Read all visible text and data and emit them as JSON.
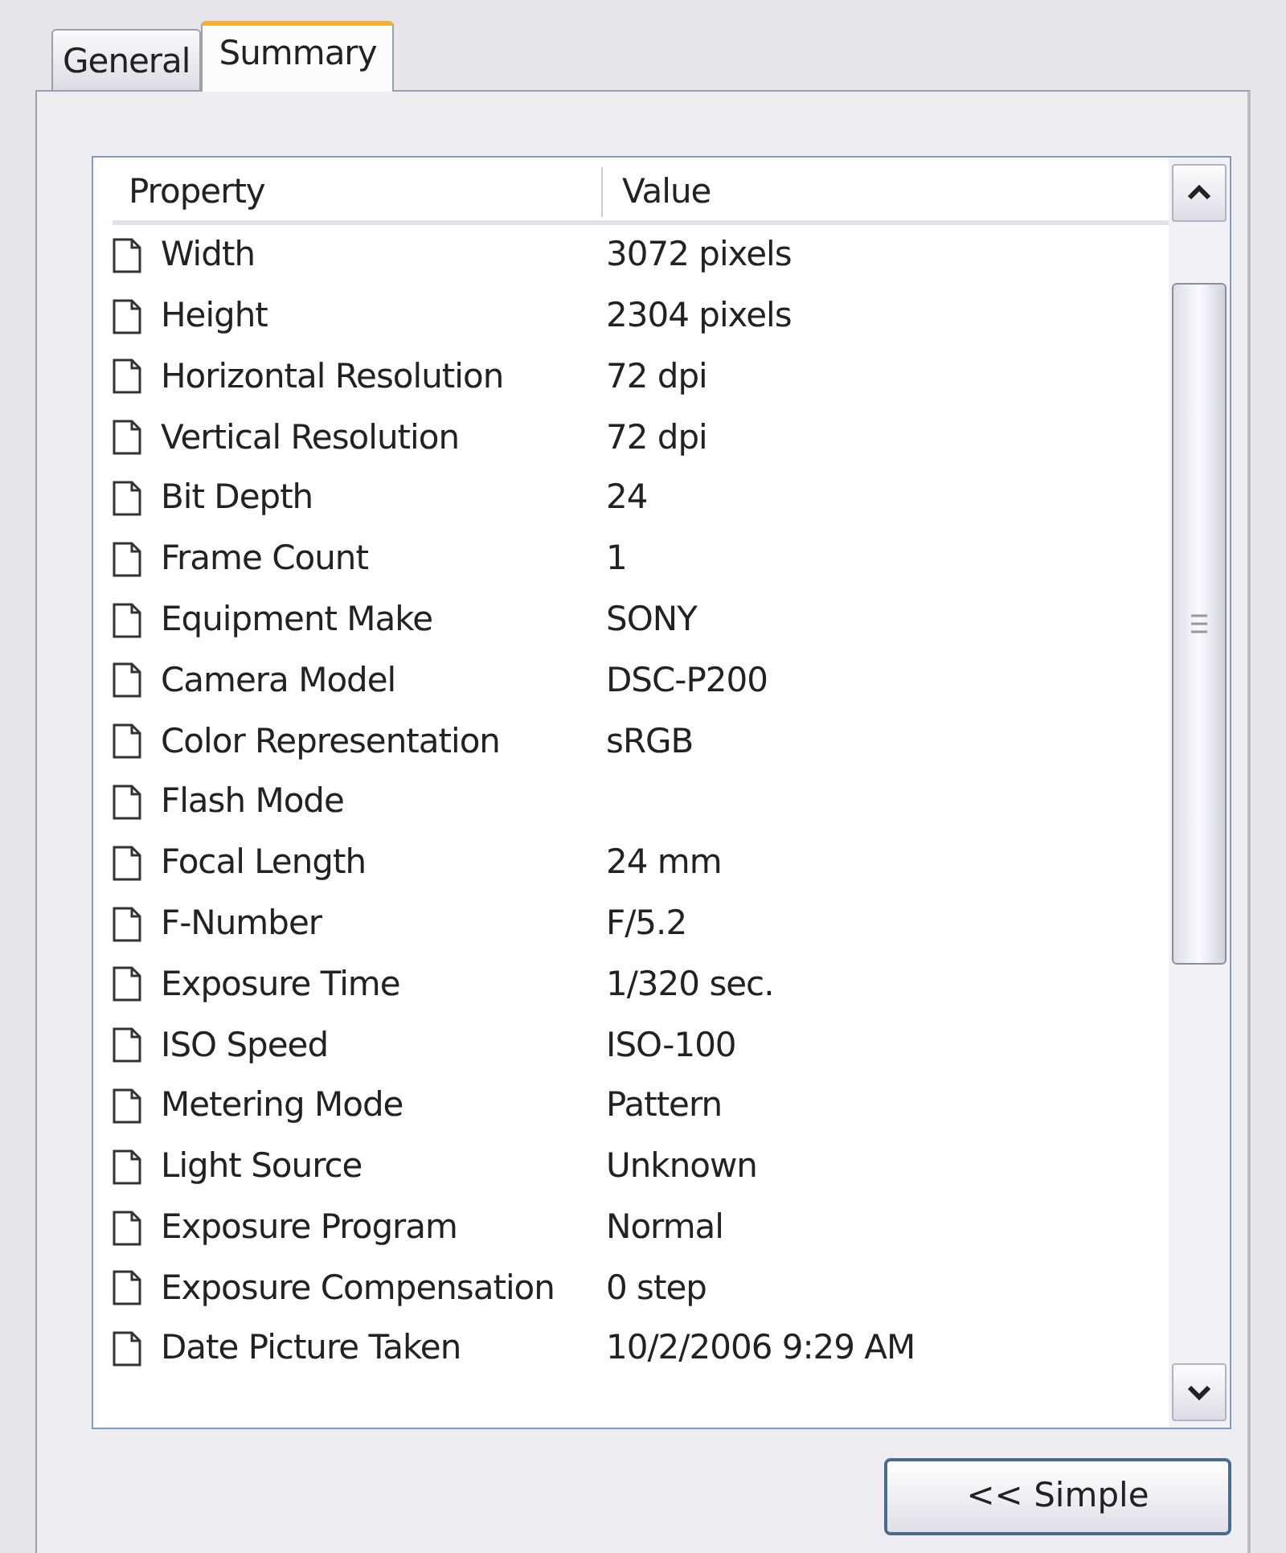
{
  "tabs": [
    {
      "label": "General",
      "selected": false
    },
    {
      "label": "Summary",
      "selected": true
    }
  ],
  "table": {
    "columns": [
      "Property",
      "Value"
    ],
    "rows": [
      {
        "property": "Width",
        "value": "3072 pixels"
      },
      {
        "property": "Height",
        "value": "2304 pixels"
      },
      {
        "property": "Horizontal Resolution",
        "value": "72 dpi"
      },
      {
        "property": "Vertical Resolution",
        "value": "72 dpi"
      },
      {
        "property": "Bit Depth",
        "value": "24"
      },
      {
        "property": "Frame Count",
        "value": "1"
      },
      {
        "property": "Equipment Make",
        "value": "SONY"
      },
      {
        "property": "Camera Model",
        "value": "DSC-P200"
      },
      {
        "property": "Color Representation",
        "value": "sRGB"
      },
      {
        "property": "Flash Mode"
      },
      {
        "property": "Focal Length",
        "value": "24 mm"
      },
      {
        "property": "F-Number",
        "value": "F/5.2"
      },
      {
        "property": "Exposure Time",
        "value": "1/320 sec."
      },
      {
        "property": "ISO Speed",
        "value": "ISO-100"
      },
      {
        "property": "Metering Mode",
        "value": "Pattern"
      },
      {
        "property": "Light Source",
        "value": "Unknown"
      },
      {
        "property": "Exposure Program",
        "value": "Normal"
      },
      {
        "property": "Exposure Compensation",
        "value": "0 step"
      },
      {
        "property": "Date Picture Taken",
        "value": "10/2/2006 9:29 AM"
      }
    ]
  },
  "buttons": [
    "<< Simple"
  ]
}
